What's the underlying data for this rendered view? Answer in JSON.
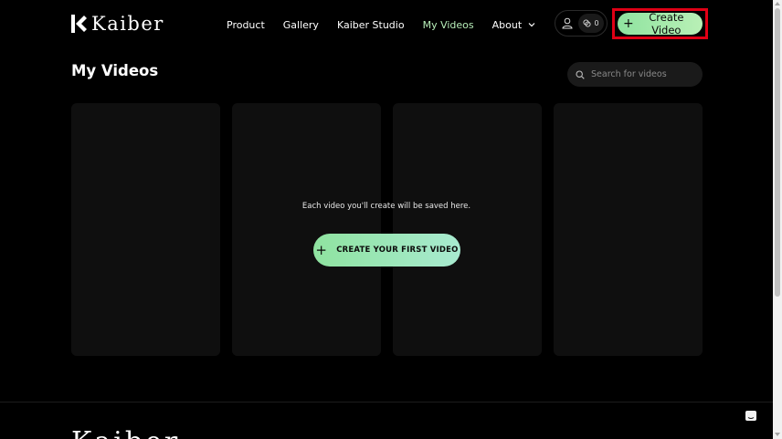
{
  "brand": {
    "name": "Kaiber",
    "footer_name": "Kaiber"
  },
  "nav": {
    "items": [
      {
        "label": "Product"
      },
      {
        "label": "Gallery"
      },
      {
        "label": "Kaiber Studio"
      },
      {
        "label": "My Videos",
        "active": true
      },
      {
        "label": "About"
      }
    ]
  },
  "account": {
    "credits": "0",
    "icons": {
      "user": "user-icon",
      "credits": "credits-icon"
    }
  },
  "header": {
    "create_label": "Create Video",
    "create_plus": "+"
  },
  "page": {
    "title": "My Videos"
  },
  "search": {
    "placeholder": "Search for videos",
    "value": ""
  },
  "empty_state": {
    "message": "Each video you'll create will be saved here.",
    "button_label": "CREATE YOUR FIRST VIDEO",
    "button_plus": "+"
  },
  "colors": {
    "accent": "#9be7a8",
    "active_nav": "#b7eeb9",
    "highlight": "#e00015",
    "background": "#000000",
    "card": "#0f0f0f"
  }
}
